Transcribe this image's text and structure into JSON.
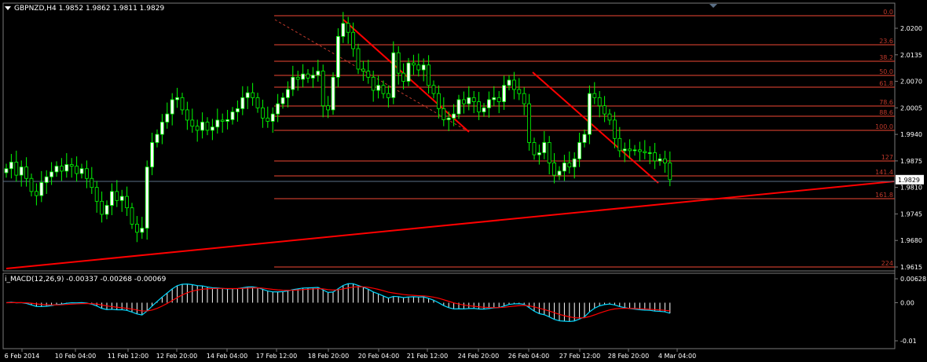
{
  "header": {
    "symbol_line": "GBPNZD,H4  1.9852 1.9862 1.9811 1.9829"
  },
  "macd": {
    "label": "i_MACD(12,26,9) -0.00337 -0.00268 -0.00069",
    "scale": [
      "0.00628",
      "0.00",
      "-0.01"
    ]
  },
  "price_scale": [
    "2.0200",
    "2.0135",
    "2.0070",
    "2.0005",
    "1.9940",
    "1.9875",
    "1.9810",
    "1.9745",
    "1.9680",
    "1.9615"
  ],
  "current_price": "1.9829",
  "fibo_levels": [
    "0.0",
    "23.6",
    "38.2",
    "50.0",
    "61.8",
    "78.6",
    "88.6",
    "100.0",
    "127",
    "141.4",
    "161.8",
    "224"
  ],
  "time_labels": [
    "6 Feb 2014",
    "10 Feb 04:00",
    "11 Feb 12:00",
    "12 Feb 20:00",
    "14 Feb 04:00",
    "17 Feb 12:00",
    "18 Feb 20:00",
    "20 Feb 04:00",
    "21 Feb 12:00",
    "24 Feb 20:00",
    "26 Feb 04:00",
    "27 Feb 12:00",
    "28 Feb 20:00",
    "4 Mar 04:00"
  ],
  "colors": {
    "background": "#000000",
    "bull_candle": "#ffffff",
    "bear_candle": "#000000",
    "candle_outline": "#00ff00",
    "fibo": "#c0392b",
    "trendline": "#ff0000",
    "macd_line": "#00d8ff",
    "signal_line": "#ff0000",
    "histogram": "#ffffff"
  },
  "chart_data": {
    "type": "candlestick",
    "symbol": "GBPNZD",
    "timeframe": "H4",
    "ylim": [
      1.9605,
      2.0235
    ],
    "close": [
      1.9856,
      1.9872,
      1.984,
      1.986,
      1.9832,
      1.98,
      1.979,
      1.9822,
      1.9836,
      1.9848,
      1.9862,
      1.985,
      1.9866,
      1.9862,
      1.9844,
      1.9856,
      1.9832,
      1.981,
      1.9776,
      1.9744,
      1.9766,
      1.98,
      1.9778,
      1.9788,
      1.976,
      1.972,
      1.97,
      1.971,
      1.986,
      1.992,
      1.994,
      1.997,
      1.999,
      2.0025,
      2.003,
      2.0,
      1.9975,
      1.996,
      1.995,
      1.997,
      1.995,
      1.9958,
      1.9975,
      1.9972,
      1.9976,
      1.9995,
      2.0003,
      2.003,
      2.0042,
      2.003,
      2.0005,
      1.998,
      1.9972,
      1.999,
      2.0015,
      2.003,
      2.005,
      2.008,
      2.0075,
      2.0088,
      2.0078,
      2.0085,
      2.0095,
      2.001,
      2.0,
      2.008,
      2.018,
      2.0212,
      2.019,
      2.015,
      2.01,
      2.0095,
      2.008,
      2.0048,
      2.006,
      2.004,
      2.003,
      2.014,
      2.009,
      2.007,
      2.0115,
      2.011,
      2.0098,
      2.011,
      2.006,
      2.004,
      2.0003,
      1.9976,
      1.998,
      1.999,
      2.0025,
      2.0015,
      2.003,
      2.002,
      1.9995,
      2.0005,
      2.0025,
      2.003,
      2.002,
      2.006,
      2.0073,
      2.005,
      2.004,
      2.0015,
      1.992,
      1.989,
      1.9895,
      1.992,
      1.987,
      1.984,
      1.985,
      1.987,
      1.986,
      1.988,
      1.992,
      1.994,
      2.004,
      2.003,
      2.001,
      1.999,
      1.9975,
      1.993,
      1.99,
      1.9904,
      1.99,
      1.9902,
      1.9898,
      1.9895,
      1.9895,
      1.9875,
      1.988,
      1.987,
      1.9829
    ],
    "fibonacci": {
      "levels": [
        0.0,
        23.6,
        38.2,
        50.0,
        61.8,
        78.6,
        88.6,
        100.0,
        127,
        141.4,
        161.8,
        224
      ]
    },
    "macd": {
      "params": [
        12,
        26,
        9
      ],
      "macd": -0.00337,
      "signal": -0.00268,
      "histogram": -0.00069,
      "ylim": [
        -0.01,
        0.00628
      ]
    }
  }
}
